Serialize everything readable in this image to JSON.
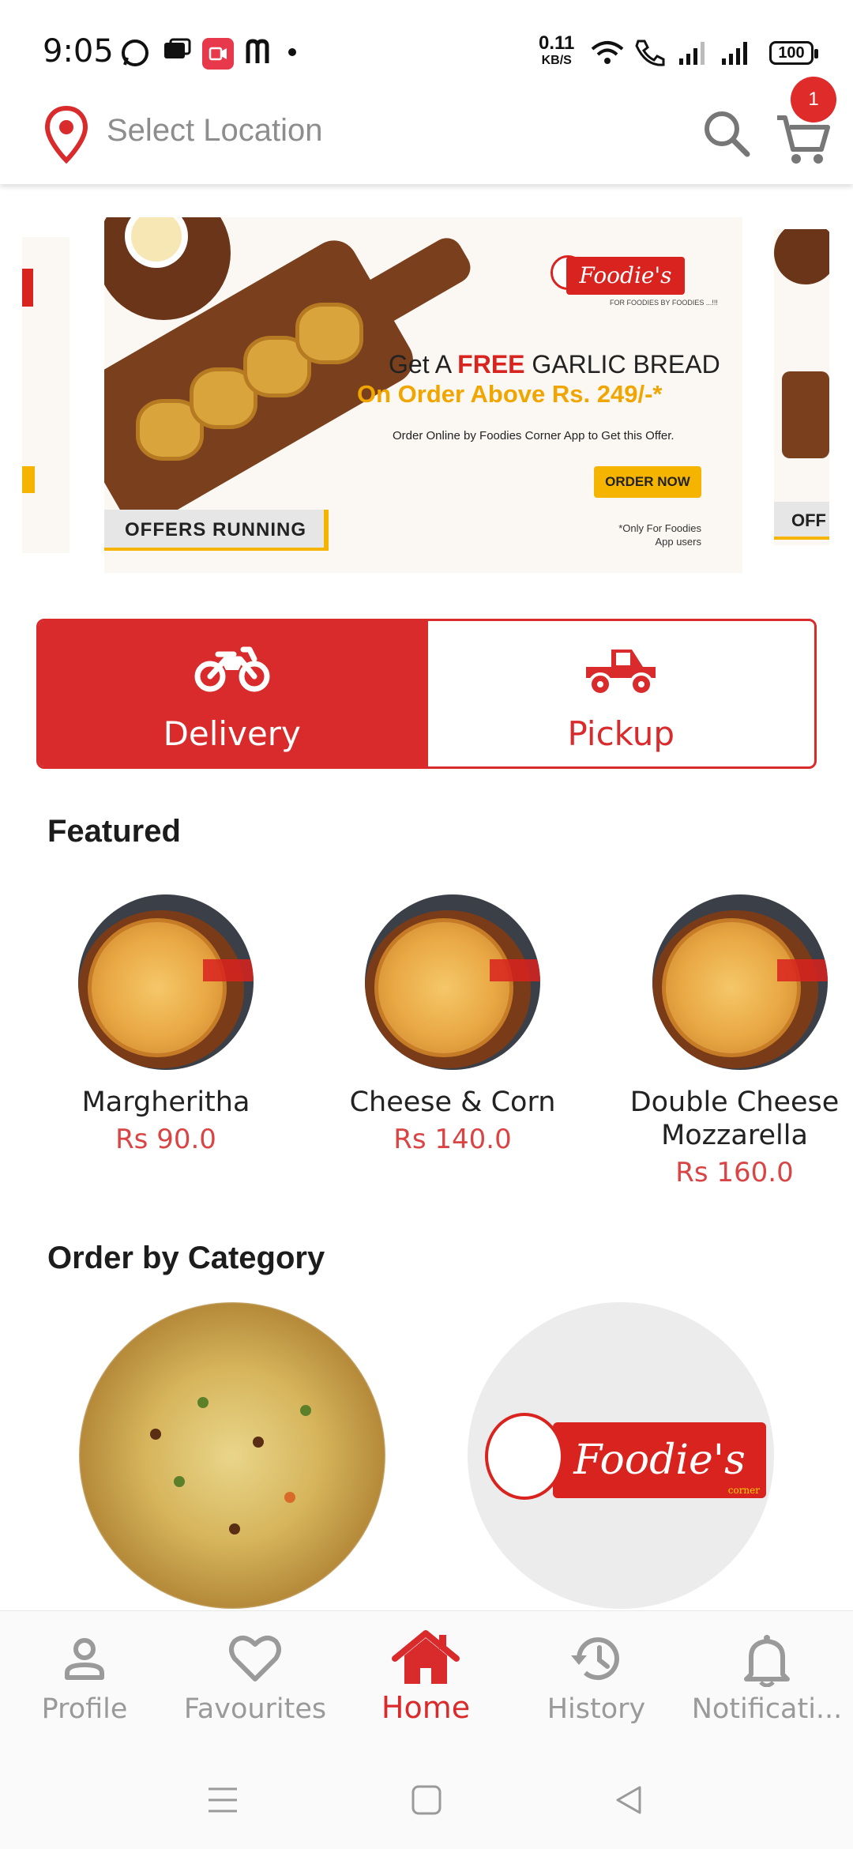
{
  "status_bar": {
    "time": "9:05",
    "net_speed_value": "0.11",
    "net_speed_unit": "KB/S",
    "battery": "100"
  },
  "app_bar": {
    "location_placeholder": "Select Location",
    "cart_count": "1"
  },
  "banner": {
    "line1_pre": "Get A ",
    "line1_highlight": "FREE",
    "line1_post": " GARLIC BREAD",
    "line2": "On Order Above Rs. 249/-*",
    "line3": "Order Online by Foodies Corner App to Get this Offer.",
    "cta": "ORDER NOW",
    "note": "*Only For Foodies App users",
    "tag": "OFFERS RUNNING",
    "brand": "Foodie's",
    "brand_tagline": "FOR FOODIES BY FOODIES ...!!!",
    "next_tag_partial": "OFF"
  },
  "order_type": {
    "delivery_label": "Delivery",
    "pickup_label": "Pickup",
    "selected": "Delivery"
  },
  "featured": {
    "title": "Featured",
    "items": [
      {
        "name": "Margheritha",
        "price": "Rs 90.0"
      },
      {
        "name": "Cheese & Corn",
        "price": "Rs 140.0"
      },
      {
        "name": "Double Cheese Mozzarella",
        "price": "Rs 160.0"
      }
    ]
  },
  "categories": {
    "title": "Order by Category",
    "logo_text": "Foodie's",
    "logo_sub": "corner"
  },
  "bottom_nav": {
    "items": [
      {
        "label": "Profile",
        "icon": "person-icon"
      },
      {
        "label": "Favourites",
        "icon": "heart-icon"
      },
      {
        "label": "Home",
        "icon": "home-icon"
      },
      {
        "label": "History",
        "icon": "history-icon"
      },
      {
        "label": "Notificati...",
        "icon": "bell-icon"
      }
    ],
    "active": "Home"
  },
  "colors": {
    "brand_red": "#d92a2c",
    "price_red": "#d94545",
    "offer_yellow": "#f4b400",
    "muted_gray": "#9a9a9a"
  }
}
